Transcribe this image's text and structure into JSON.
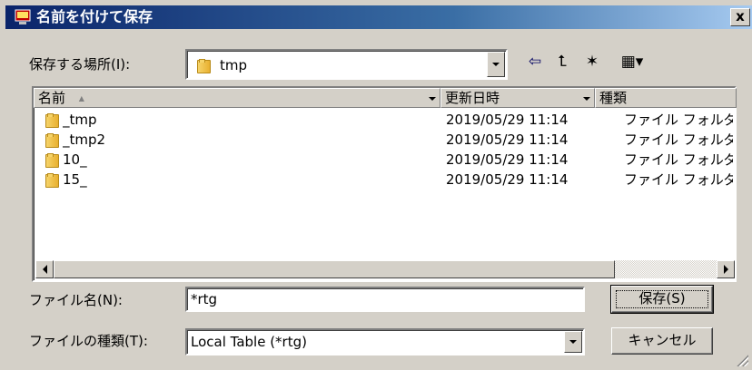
{
  "window": {
    "title": "名前を付けて保存",
    "close_label": "x"
  },
  "location": {
    "label": "保存する場所(I):",
    "value": "tmp"
  },
  "toolbar": {
    "back_glyph": "⇦",
    "up_glyph": "⮤",
    "new_folder_glyph": "✶",
    "view_glyph": "▦▾"
  },
  "columns": [
    {
      "label": "名前",
      "sort": "▲"
    },
    {
      "label": "更新日時"
    },
    {
      "label": "種類"
    }
  ],
  "files": [
    {
      "name": "_tmp",
      "modified": "2019/05/29 11:14",
      "type": "ファイル フォルダー"
    },
    {
      "name": "_tmp2",
      "modified": "2019/05/29 11:14",
      "type": "ファイル フォルダー"
    },
    {
      "name": "10_",
      "modified": "2019/05/29 11:14",
      "type": "ファイル フォルダー"
    },
    {
      "name": "15_",
      "modified": "2019/05/29 11:14",
      "type": "ファイル フォルダー"
    }
  ],
  "filename": {
    "label": "ファイル名(N):",
    "value": "*rtg"
  },
  "filetype": {
    "label": "ファイルの種類(T):",
    "value": "Local Table (*rtg)"
  },
  "buttons": {
    "save": "保存(S)",
    "cancel": "キャンセル"
  }
}
